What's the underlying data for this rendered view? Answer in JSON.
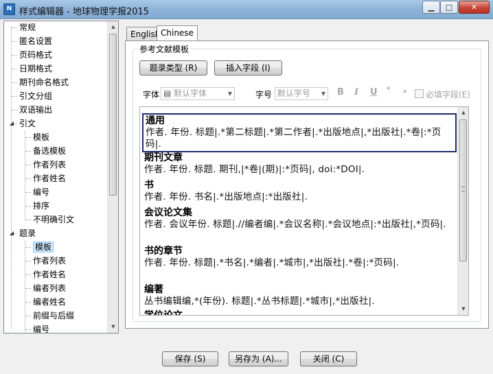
{
  "window": {
    "title": "样式编辑器 - 地球物理学报2015",
    "app_icon_text": "N",
    "minimize": "▁",
    "maximize": "□",
    "close": "✕"
  },
  "tree": {
    "items": [
      {
        "label": "常规",
        "level": 0
      },
      {
        "label": "匿名设置",
        "level": 0
      },
      {
        "label": "页码格式",
        "level": 0
      },
      {
        "label": "日期格式",
        "level": 0
      },
      {
        "label": "期刊命名格式",
        "level": 0
      },
      {
        "label": "引文分组",
        "level": 0
      },
      {
        "label": "双语输出",
        "level": 0
      },
      {
        "label": "引文",
        "level": 0,
        "expanded": true
      },
      {
        "label": "模板",
        "level": 1
      },
      {
        "label": "备选模板",
        "level": 1
      },
      {
        "label": "作者列表",
        "level": 1
      },
      {
        "label": "作者姓名",
        "level": 1
      },
      {
        "label": "编号",
        "level": 1
      },
      {
        "label": "排序",
        "level": 1
      },
      {
        "label": "不明确引文",
        "level": 1
      },
      {
        "label": "题录",
        "level": 0,
        "expanded": true
      },
      {
        "label": "模板",
        "level": 1,
        "selected": true
      },
      {
        "label": "作者列表",
        "level": 1
      },
      {
        "label": "作者姓名",
        "level": 1
      },
      {
        "label": "编者列表",
        "level": 1
      },
      {
        "label": "编者姓名",
        "level": 1
      },
      {
        "label": "前缀与后缀",
        "level": 1
      },
      {
        "label": "编号",
        "level": 1
      }
    ]
  },
  "tabs": [
    {
      "label": "English",
      "active": false
    },
    {
      "label": "Chinese",
      "active": true
    }
  ],
  "group": {
    "legend": "参考文献模板",
    "type_button": "题录类型 (R)",
    "insert_button": "插入字段 (I)",
    "font_label": "字体",
    "font_value": "默认字体",
    "size_label": "字号",
    "size_value": "默认字号",
    "bold": "B",
    "italic": "I",
    "underline": "U",
    "superscript": "ˣ",
    "subscript": "ₓ",
    "required_label": "必填字段(E)"
  },
  "entries": [
    {
      "head": "通用",
      "tmpl": "作者. 年份. 标题|.*第二标题|.*第二作者|.*出版地点|,*出版社|.*卷|:*页码|.",
      "selected": true
    },
    {
      "head": "期刊文章",
      "tmpl": "作者. 年份. 标题. 期刊,|*卷|(期)|:*页码|, doi:*DOI|."
    },
    {
      "head": "书",
      "tmpl": "作者. 年份. 书名|.*出版地点|:*出版社|."
    },
    {
      "head": "会议论文集",
      "tmpl": "作者. 会议年份. 标题|.//编者编|.*会议名称|.*会议地点|:*出版社|,*页码|."
    },
    {
      "head": "书的章节",
      "tmpl": "作者. 年份. 标题|.*书名|.*编者|.*城市|,*出版社|.*卷|:*页码|."
    },
    {
      "head": "编著",
      "tmpl": "丛书编辑编,*(年份). 标题|.*丛书标题|.*城市|,*出版社|."
    },
    {
      "head": "学位论文",
      "tmpl": ""
    }
  ],
  "footer": {
    "save": "保存 (S)",
    "save_as": "另存为 (A)...",
    "close": "关闭 (C)"
  },
  "colors": {
    "selection_border": "#1c2a6e",
    "tree_selection": "#cde8ff"
  }
}
